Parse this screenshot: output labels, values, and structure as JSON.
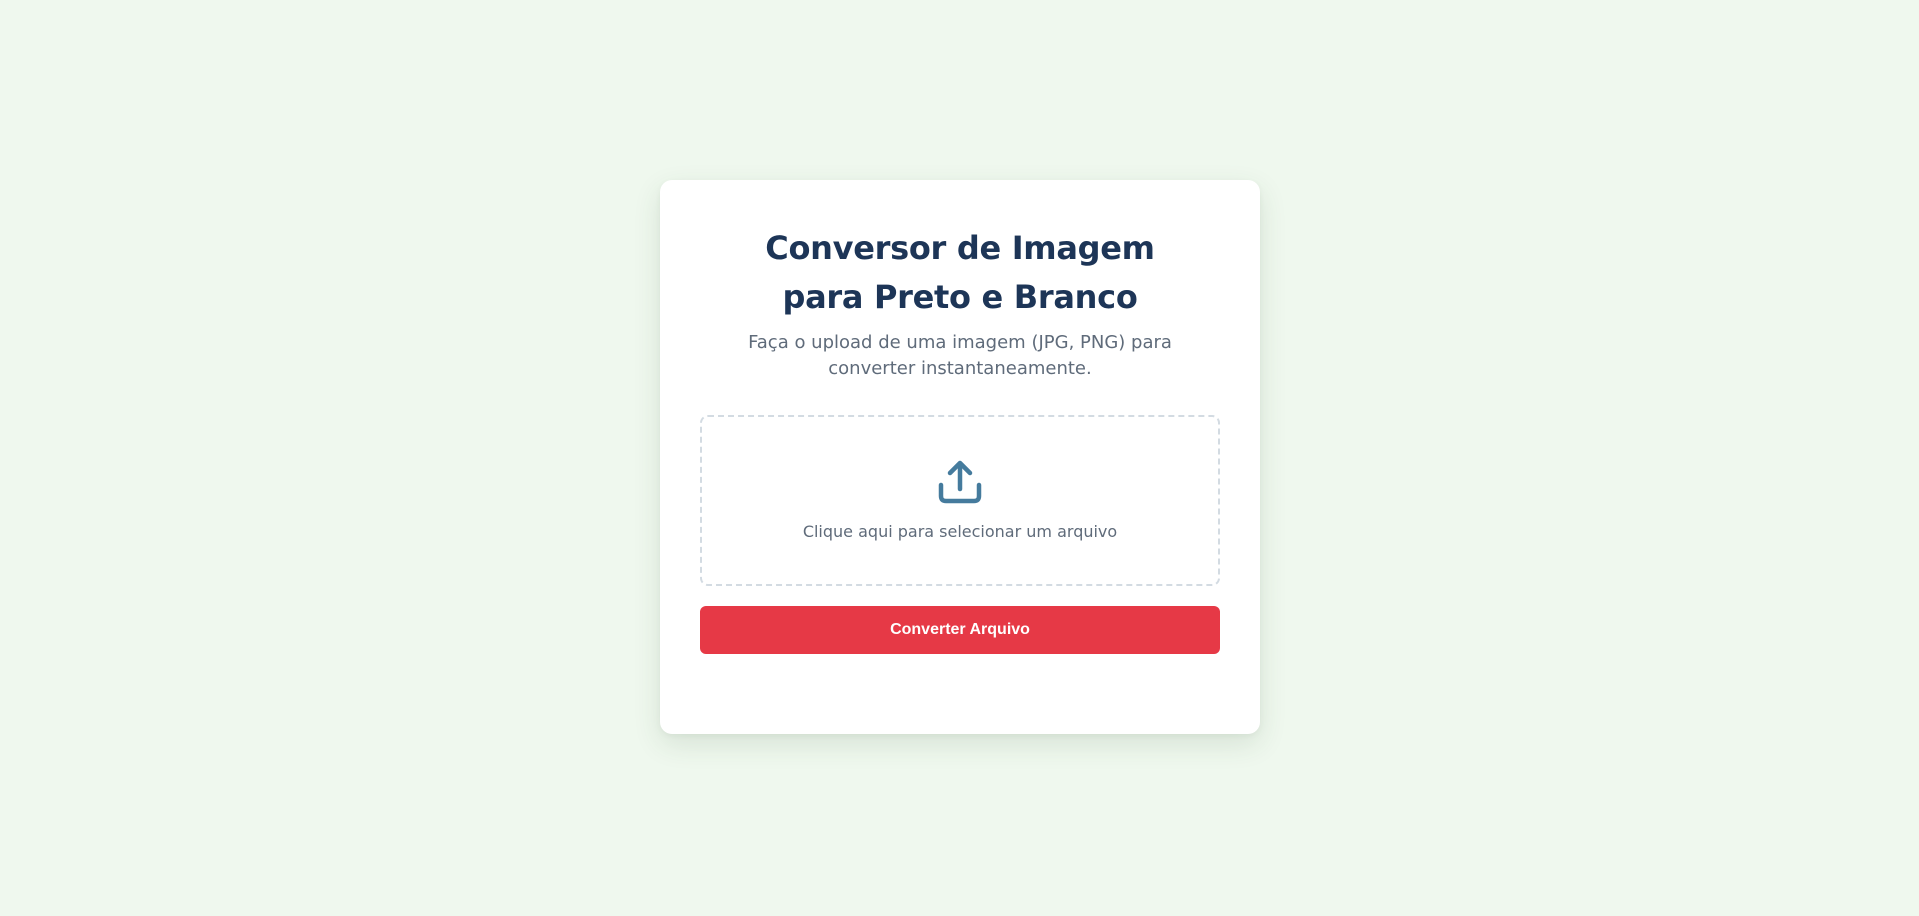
{
  "card": {
    "title": "Conversor de Imagem para Preto e Branco",
    "subtitle": "Faça o upload de uma imagem (JPG, PNG) para converter instantaneamente.",
    "dropzone": {
      "icon": "upload-icon",
      "label": "Clique aqui para selecionar um arquivo"
    },
    "convert_button_label": "Converter Arquivo"
  },
  "colors": {
    "background": "#eff8ee",
    "card": "#ffffff",
    "title": "#1d3557",
    "body_text": "#5f6b7a",
    "icon": "#457b9d",
    "accent": "#e63946",
    "dropzone_border": "#d3dbe2"
  }
}
